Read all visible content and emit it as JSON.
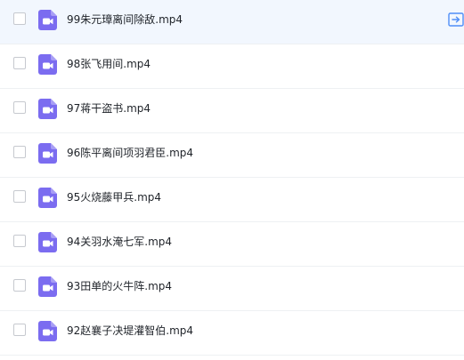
{
  "file_list": {
    "icon": "video-file-icon",
    "icon_color": "#7b6cf0",
    "row_action_icon": "move-to-icon",
    "row_action_color": "#4f8ef7",
    "hovered_index": 0,
    "items": [
      {
        "name": "99朱元璋离间除敌.mp4"
      },
      {
        "name": "98张飞用间.mp4"
      },
      {
        "name": "97蒋干盗书.mp4"
      },
      {
        "name": "96陈平离间项羽君臣.mp4"
      },
      {
        "name": "95火烧藤甲兵.mp4"
      },
      {
        "name": "94关羽水淹七军.mp4"
      },
      {
        "name": "93田单的火牛阵.mp4"
      },
      {
        "name": "92赵襄子决堤灌智伯.mp4"
      }
    ]
  }
}
